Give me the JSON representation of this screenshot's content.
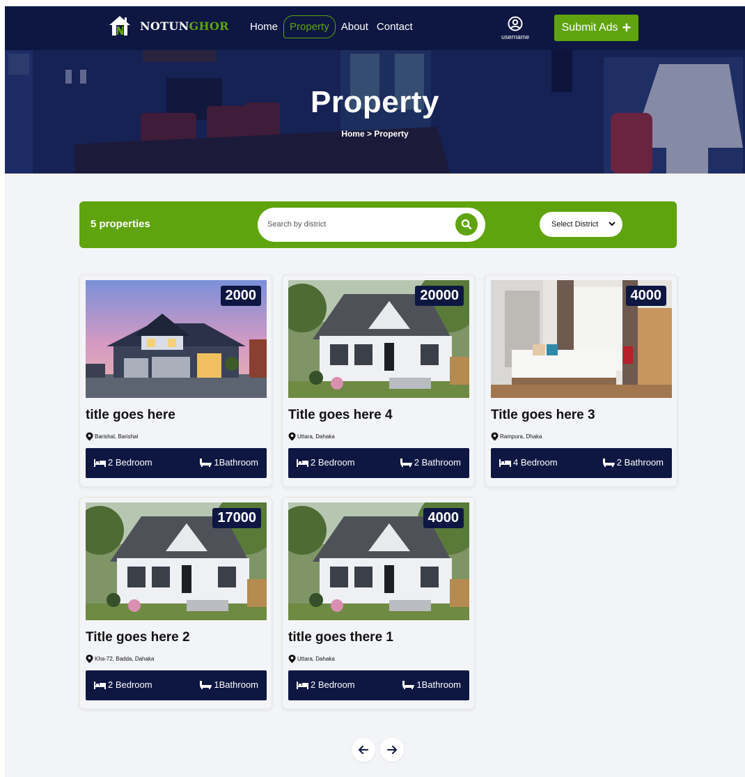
{
  "navbar": {
    "brand_prefix": "NOTUN",
    "brand_suffix": "GHOR",
    "links": [
      "Home",
      "Property",
      "About",
      "Contact"
    ],
    "active": "Property",
    "username": "username",
    "submit_label": "Submit Ads"
  },
  "hero": {
    "title": "Property",
    "breadcrumb": "Home > Property"
  },
  "filter": {
    "count_label": "5 properties",
    "search_placeholder": "Search by district",
    "select_value": "Select District"
  },
  "listings": [
    {
      "title": "title goes here",
      "location": "Barishal, Barishal",
      "price": "2000",
      "bedrooms": "2 Bedroom",
      "bathrooms": "1Bathroom",
      "image": "house-dusk"
    },
    {
      "title": "Title goes here 4",
      "location": "Uttara, Dahaka",
      "price": "20000",
      "bedrooms": "2 Bedroom",
      "bathrooms": "2 Bathroom",
      "image": "white-cottage"
    },
    {
      "title": "Title goes here 3",
      "location": "Rampura, Dhaka",
      "price": "4000",
      "bedrooms": "4 Bedroom",
      "bathrooms": "2 Bathroom",
      "image": "bedroom"
    },
    {
      "title": "Title goes here 2",
      "location": "Kha-72, Badda, Dahaka",
      "price": "17000",
      "bedrooms": "2 Bedroom",
      "bathrooms": "1Bathroom",
      "image": "white-cottage"
    },
    {
      "title": "title goes there 1",
      "location": "Uttara, Dahaka",
      "price": "4000",
      "bedrooms": "2 Bedroom",
      "bathrooms": "1Bathroom",
      "image": "white-cottage"
    }
  ],
  "pagination": {
    "prev_icon": "arrow-left-icon",
    "next_icon": "arrow-right-icon"
  },
  "colors": {
    "navy": "#0d1742",
    "green": "#5fa30e",
    "background": "#f3f4f7"
  }
}
